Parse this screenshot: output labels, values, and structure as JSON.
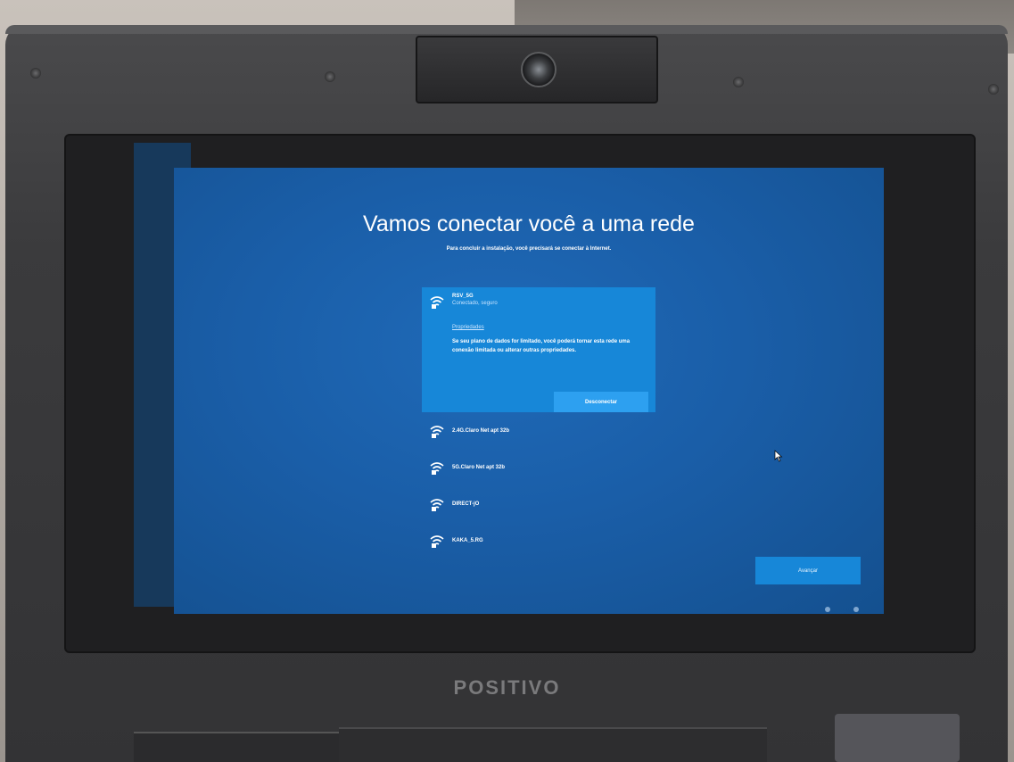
{
  "device": {
    "brand": "POSITIVO"
  },
  "setup": {
    "title": "Vamos conectar você a uma rede",
    "subtitle": "Para concluir a instalação, você precisará se conectar à Internet."
  },
  "networks": {
    "selected": {
      "name": "RSV_5G",
      "status": "Conectado, seguro",
      "properties_link": "Propriedades",
      "description": "Se seu plano de dados for limitado, você poderá tornar esta rede uma conexão limitada ou alterar outras propriedades.",
      "disconnect_label": "Desconectar"
    },
    "items": [
      {
        "name": "2.4G.Claro Net apt 32b"
      },
      {
        "name": "5G.Claro Net apt 32b"
      },
      {
        "name": "DIRECT-jO"
      },
      {
        "name": "KAKA_5.RG"
      }
    ]
  },
  "footer": {
    "advance_label": "Avançar"
  },
  "colors": {
    "screen_bg": "#1a5ea8",
    "selected_bg": "#1787d8",
    "button_bg": "#2da0f0"
  },
  "icons": {
    "network": "wifi-secured-icon"
  }
}
